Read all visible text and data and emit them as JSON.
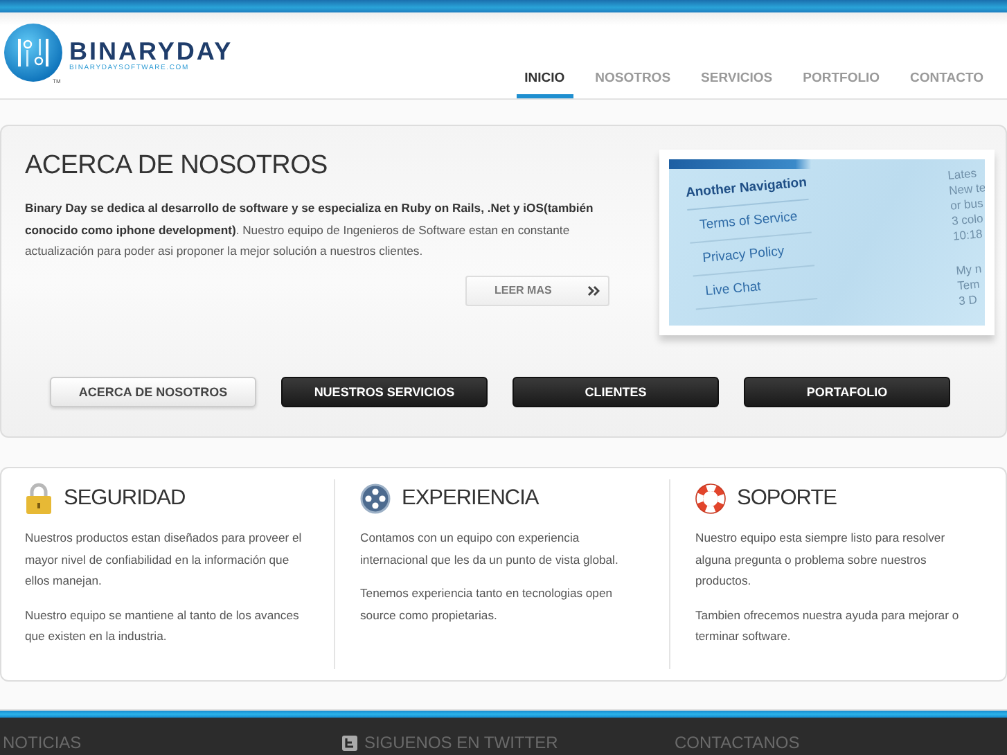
{
  "logo": {
    "name": "BINARYDAY",
    "url": "BINARYDAYSOFTWARE.COM",
    "tm": "TM"
  },
  "nav": [
    {
      "label": "INICIO",
      "selected": true
    },
    {
      "label": "NOSOTROS",
      "selected": false
    },
    {
      "label": "SERVICIOS",
      "selected": false
    },
    {
      "label": "PORTFOLIO",
      "selected": false
    },
    {
      "label": "CONTACTO",
      "selected": false
    }
  ],
  "about": {
    "title": "ACERCA DE NOSOTROS",
    "text": "**Binary Day se dedica al desarrollo de software y se especializa en Ruby on Rails, .Net y iOS(también conocido como iphone development)**. Nuestro equipo de Ingenieros de Software estan en constante actualización para poder asi proponer la mejor solución a nuestros clientes.",
    "button": "LEER MAS"
  },
  "preview": {
    "heading": "Another Navigation",
    "links": [
      "Terms of Service",
      "Privacy Policy",
      "Live Chat"
    ],
    "side": [
      "Lates",
      "New te",
      "or bus",
      "3 colo",
      "10:18",
      "My n",
      "Tem",
      "3 D"
    ]
  },
  "sections": [
    {
      "label": "ACERCA DE NOSOTROS",
      "selected": true
    },
    {
      "label": "NUESTROS SERVICIOS",
      "selected": false
    },
    {
      "label": "CLIENTES",
      "selected": false
    },
    {
      "label": "PORTAFOLIO",
      "selected": false
    }
  ],
  "features": [
    {
      "kind": "lock",
      "title": "SEGURIDAD",
      "paragraphs": [
        "Nuestros productos estan diseñados para proveer el mayor nivel de confiabilidad en la información que ellos manejan.",
        "Nuestro equipo se mantiene al tanto de los avances que existen en la industria."
      ]
    },
    {
      "kind": "reel",
      "title": "EXPERIENCIA",
      "paragraphs": [
        "Contamos con un equipo con experiencia internacional que les da un punto de vista global.",
        "Tenemos experiencia tanto en tecnologias open source como propietarias."
      ]
    },
    {
      "kind": "lifebuoy",
      "title": "SOPORTE",
      "paragraphs": [
        "Nuestro equipo esta siempre listo para resolver alguna pregunta o problema sobre nuestros productos.",
        "Tambien ofrecemos nuestra ayuda para mejorar o terminar software."
      ]
    }
  ],
  "footer": [
    {
      "kind": "plain",
      "title": "NOTICIAS"
    },
    {
      "kind": "twitter",
      "title": "SIGUENOS EN TWITTER"
    },
    {
      "kind": "plain",
      "title": "CONTACTANOS"
    }
  ]
}
